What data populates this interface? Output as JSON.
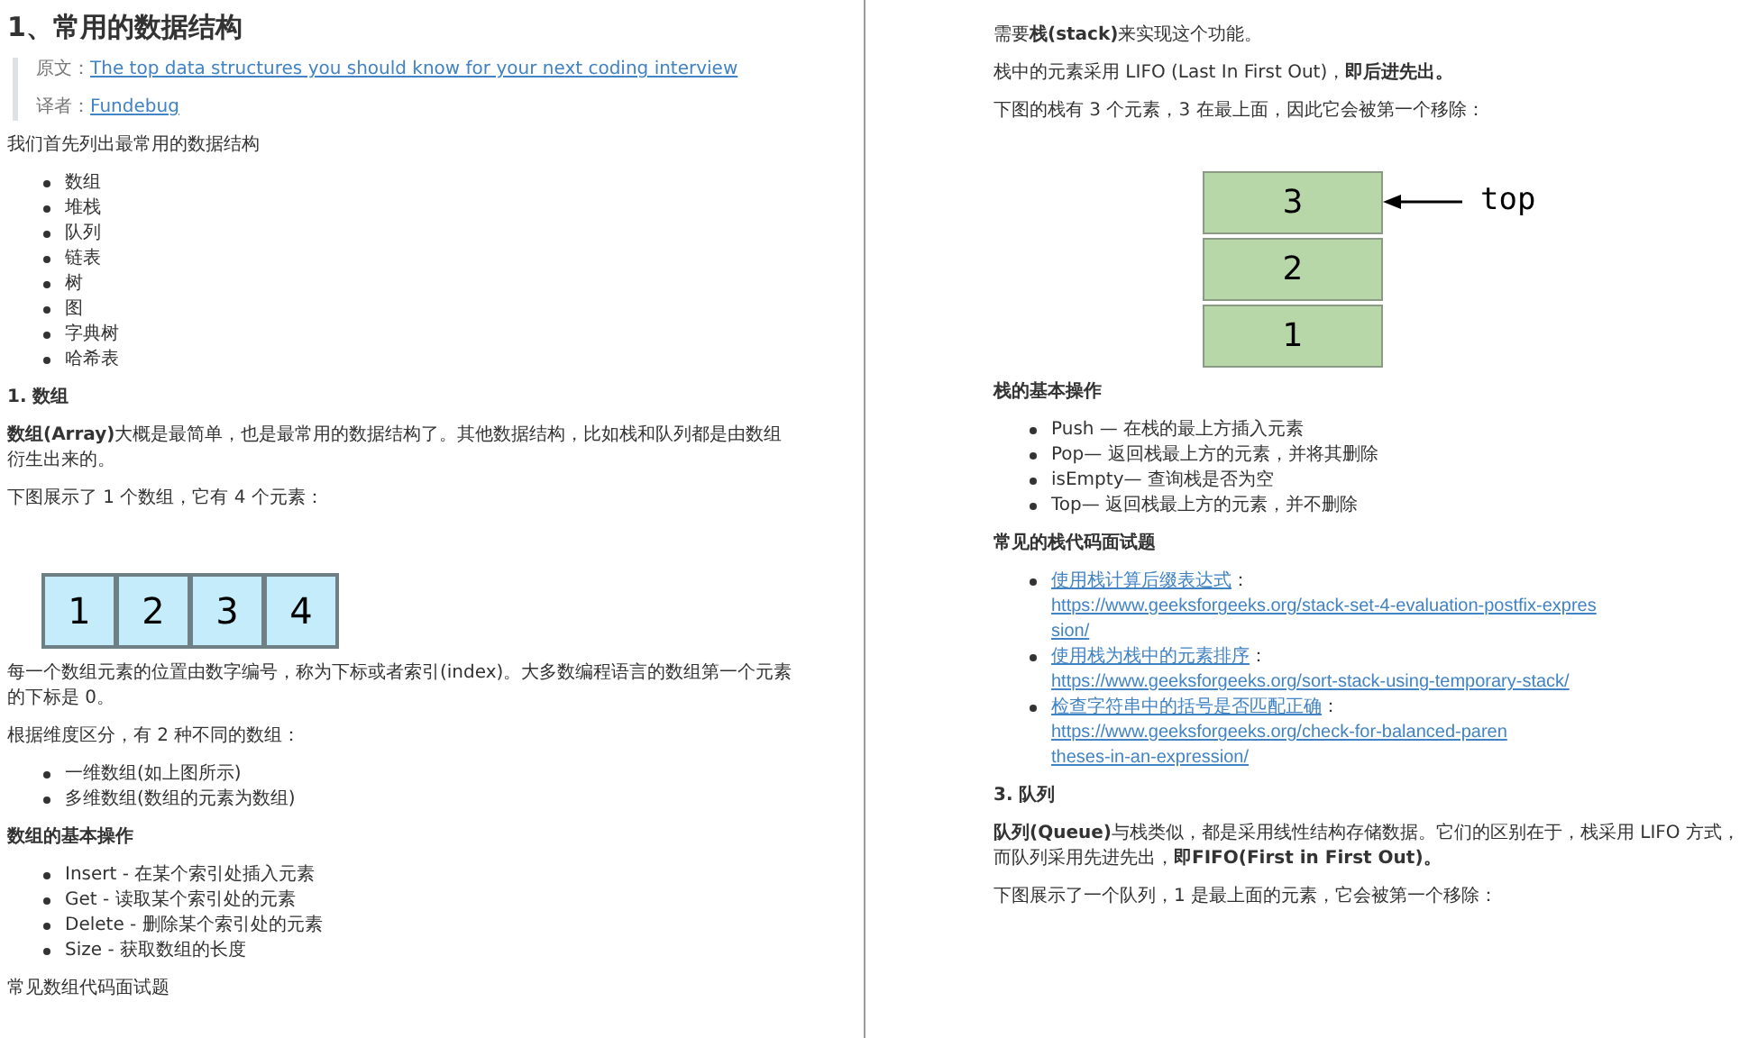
{
  "left_page": {
    "title": "1、常用的数据结构",
    "quote": [
      {
        "label": "原文：",
        "link": "The top data structures you should know for your next coding interview"
      },
      {
        "label": "译者：",
        "link": "Fundebug"
      }
    ],
    "blocks": [
      {
        "kind": "paragraph",
        "text": "我们首先列出最常用的数据结构"
      },
      {
        "kind": "list",
        "items": [
          "数组",
          "堆栈",
          "队列",
          "链表",
          "树",
          "图",
          "字典树",
          "哈希表"
        ]
      },
      {
        "kind": "heading",
        "text": "1. 数组"
      },
      {
        "kind": "paragraph",
        "text": "**数组(Array)**大概是最简单，也是最常用的数据结构了。其他数据结构，比如栈和队列都是由数组衍生出来的。"
      },
      {
        "kind": "paragraph",
        "text": "下图展示了 1 个数组，它有 4 个元素："
      },
      {
        "kind": "array_diagram",
        "cells": [
          "1",
          "2",
          "3",
          "4"
        ]
      },
      {
        "kind": "paragraph",
        "text": "每一个数组元素的位置由数字编号，称为下标或者索引(index)。大多数编程语言的数组第一个元素的下标是 0。"
      },
      {
        "kind": "paragraph",
        "text": "根据维度区分，有 2 种不同的数组："
      },
      {
        "kind": "list",
        "items": [
          "一维数组(如上图所示)",
          "多维数组(数组的元素为数组)"
        ]
      },
      {
        "kind": "heading",
        "text": "数组的基本操作"
      },
      {
        "kind": "list",
        "items": [
          "Insert - 在某个索引处插入元素",
          "Get - 读取某个索引处的元素",
          "Delete - 删除某个索引处的元素",
          "Size - 获取数组的长度"
        ]
      },
      {
        "kind": "paragraph",
        "text": "常见数组代码面试题"
      }
    ]
  },
  "right_page": {
    "blocks": [
      {
        "kind": "paragraph",
        "text": "需要**栈(stack)**来实现这个功能。"
      },
      {
        "kind": "paragraph",
        "text": "栈中的元素采用 LIFO (Last In First Out)，**即后进先出。**"
      },
      {
        "kind": "paragraph",
        "text": "下图的栈有 3 个元素，3 在最上面，因此它会被第一个移除："
      },
      {
        "kind": "stack_diagram",
        "cells": [
          "3",
          "2",
          "1"
        ],
        "pointer_label": "top"
      },
      {
        "kind": "heading",
        "text": "栈的基本操作"
      },
      {
        "kind": "list",
        "items": [
          "Push — 在栈的最上方插入元素",
          "Pop— 返回栈最上方的元素，并将其删除",
          "isEmpty— 查询栈是否为空",
          "Top— 返回栈最上方的元素，并不删除"
        ]
      },
      {
        "kind": "heading",
        "text": "常见的栈代码面试题"
      },
      {
        "kind": "link_list",
        "items": [
          {
            "label": "使用栈计算后缀表达式",
            "separator": "：",
            "url_lines": [
              "https://www.geeksforgeeks.org/stack-set-4-evaluation-postfix-expres",
              "sion/"
            ]
          },
          {
            "label": "使用栈为栈中的元素排序",
            "separator": "：",
            "url_lines": [
              "https://www.geeksforgeeks.org/sort-stack-using-temporary-stack/"
            ]
          },
          {
            "label": "检查字符串中的括号是否匹配正确",
            "separator": "：",
            "url_lines": [
              "https://www.geeksforgeeks.org/check-for-balanced-paren",
              "theses-in-an-expression/"
            ]
          }
        ]
      },
      {
        "kind": "heading",
        "text": "3. 队列"
      },
      {
        "kind": "paragraph",
        "text": "**队列(Queue)**与栈类似，都是采用线性结构存储数据。它们的区别在于，栈采用 LIFO 方式，而队列采用先进先出，**即FIFO(First in First Out)。**"
      },
      {
        "kind": "paragraph",
        "text": "下图展示了一个队列，1 是最上面的元素，它会被第一个移除："
      }
    ]
  }
}
